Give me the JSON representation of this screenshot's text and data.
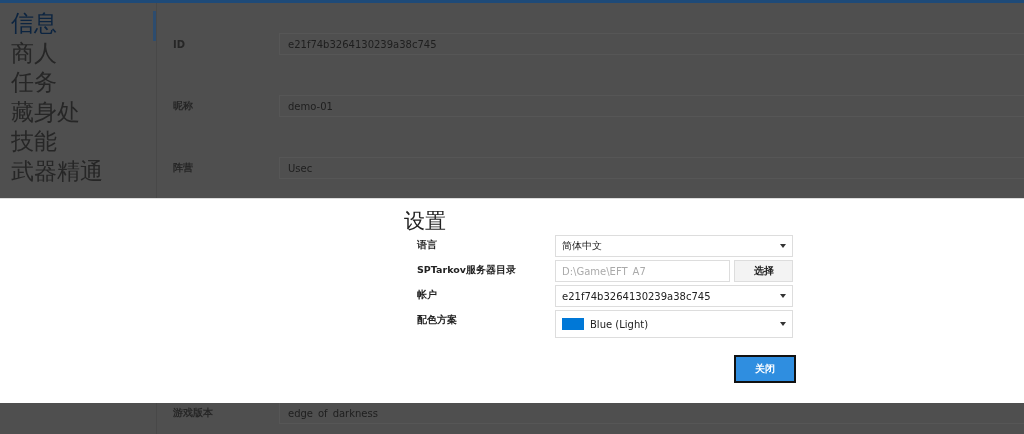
{
  "sidebar": {
    "items": [
      {
        "label": "信息",
        "selected": true
      },
      {
        "label": "商人",
        "selected": false
      },
      {
        "label": "任务",
        "selected": false
      },
      {
        "label": "藏身处",
        "selected": false
      },
      {
        "label": "技能",
        "selected": false
      },
      {
        "label": "武器精通",
        "selected": false
      }
    ]
  },
  "profile_fields": [
    {
      "label": "ID",
      "value": "e21f74b3264130239a38c745"
    },
    {
      "label": "昵称",
      "value": "demo-01"
    },
    {
      "label": "阵营",
      "value": "Usec"
    },
    {
      "label": "游戏版本",
      "value": "edge_of_darkness"
    }
  ],
  "settings_dialog": {
    "title": "设置",
    "rows": [
      {
        "kind": "dropdown",
        "label": "语言",
        "value": "简体中文"
      },
      {
        "kind": "folder",
        "label": "SPTarkov服务器目录",
        "placeholder": "D:\\Game\\EFT_A7",
        "button": "选择"
      },
      {
        "kind": "dropdown",
        "label": "帐户",
        "value": "e21f74b3264130239a38c745"
      },
      {
        "kind": "color",
        "label": "配色方案",
        "value": "Blue (Light)",
        "color": "#0078d7"
      }
    ],
    "close_button": "关闭"
  }
}
